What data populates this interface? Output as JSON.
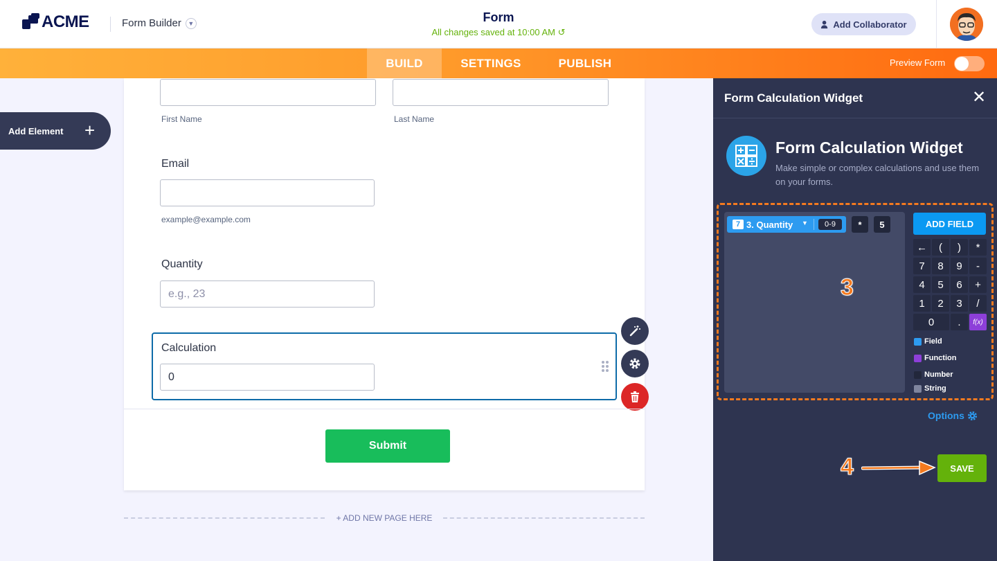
{
  "header": {
    "logo_text": "ACME",
    "app_name": "Form Builder",
    "form_title": "Form",
    "saved_status": "All changes saved at 10:00 AM",
    "collaborator_label": "Add Collaborator"
  },
  "nav": {
    "tabs": [
      {
        "label": "BUILD",
        "active": true
      },
      {
        "label": "SETTINGS",
        "active": false
      },
      {
        "label": "PUBLISH",
        "active": false
      }
    ],
    "preview_label": "Preview Form",
    "preview_enabled": false
  },
  "sidebar": {
    "add_element_label": "Add Element"
  },
  "form": {
    "first_name_sub": "First Name",
    "last_name_sub": "Last Name",
    "email_label": "Email",
    "email_sub": "example@example.com",
    "quantity_label": "Quantity",
    "quantity_placeholder": "e.g., 23",
    "calculation_label": "Calculation",
    "calculation_value": "0",
    "submit_label": "Submit",
    "add_page_label": "+ ADD NEW PAGE HERE"
  },
  "panel": {
    "title": "Form Calculation Widget",
    "widget_title": "Form Calculation Widget",
    "widget_desc": "Make simple or complex calculations and use them on your forms.",
    "formula": {
      "field_index": "7",
      "field_label": "3. Quantity",
      "field_range": "0-9",
      "operator": "*",
      "number": "5"
    },
    "add_field_label": "ADD FIELD",
    "keypad": [
      "←",
      "(",
      ")",
      "*",
      "7",
      "8",
      "9",
      "-",
      "4",
      "5",
      "6",
      "+",
      "1",
      "2",
      "3",
      "/",
      "0",
      ".",
      "f(x)"
    ],
    "legend": [
      {
        "label": "Field",
        "color": "#2d9bf0"
      },
      {
        "label": "Function",
        "color": "#8d3fd9"
      },
      {
        "label": "Number",
        "color": "#22273b"
      },
      {
        "label": "String",
        "color": "#7f859e"
      }
    ],
    "options_label": "Options",
    "save_label": "SAVE"
  },
  "annotations": {
    "step_3": "3",
    "step_4": "4"
  },
  "colors": {
    "brand": "#0a1551",
    "accent_orange": "#ff6a10",
    "save_green": "#64b20b",
    "submit_green": "#18bd5b",
    "field_blue": "#2d9bf0",
    "delete_red": "#dc2626"
  }
}
